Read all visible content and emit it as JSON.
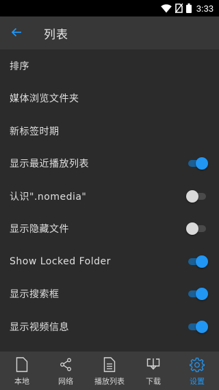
{
  "status_bar": {
    "time": "3:33"
  },
  "app_bar": {
    "title": "列表",
    "back_icon": "arrow-left-icon"
  },
  "settings": [
    {
      "label": "排序",
      "toggle": null
    },
    {
      "label": "媒体浏览文件夹",
      "toggle": null
    },
    {
      "label": "新标签时期",
      "toggle": null
    },
    {
      "label": "显示最近播放列表",
      "toggle": true
    },
    {
      "label": "认识\".nomedia\"",
      "toggle": false
    },
    {
      "label": "显示隐藏文件",
      "toggle": false
    },
    {
      "label": "Show Locked Folder",
      "toggle": true
    },
    {
      "label": "显示搜索框",
      "toggle": true
    },
    {
      "label": "显示视频信息",
      "toggle": true
    }
  ],
  "bottom_nav": {
    "items": [
      {
        "label": "本地",
        "icon": "file-icon",
        "active": false
      },
      {
        "label": "网络",
        "icon": "share-icon",
        "active": false
      },
      {
        "label": "播放列表",
        "icon": "list-document-icon",
        "active": false
      },
      {
        "label": "下载",
        "icon": "download-icon",
        "active": false
      },
      {
        "label": "设置",
        "icon": "gear-icon",
        "active": true
      }
    ]
  },
  "colors": {
    "accent": "#2196f3",
    "background": "#2b2b2b",
    "app_bar": "#373737",
    "bottom_nav": "#3c3c3c"
  }
}
